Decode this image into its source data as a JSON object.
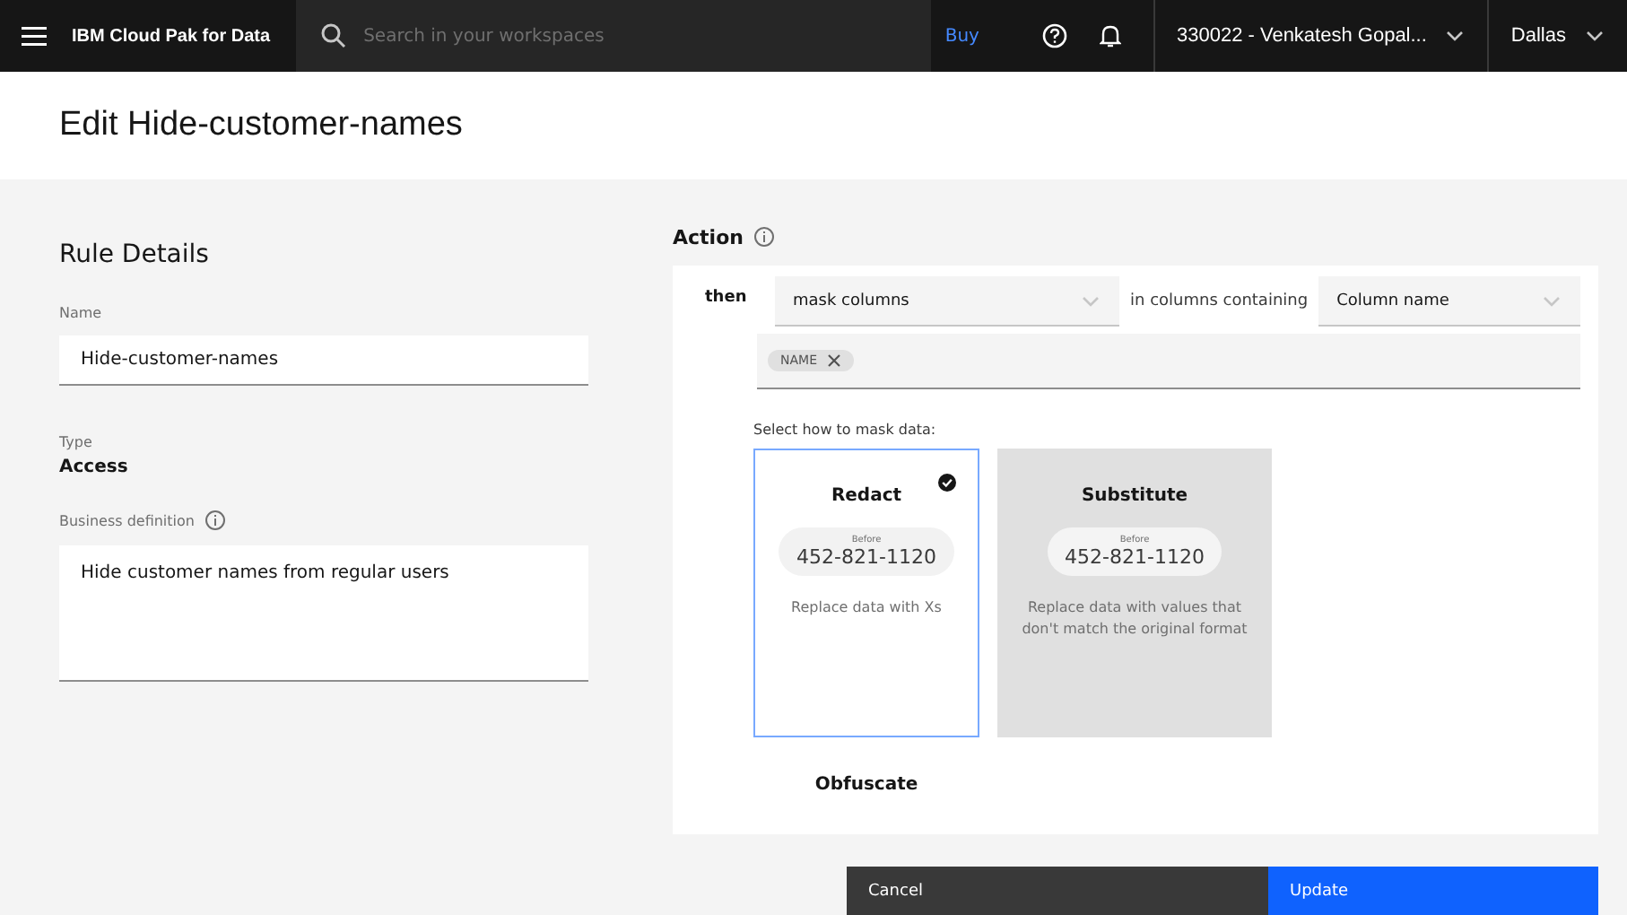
{
  "topbar": {
    "product": "IBM Cloud Pak for Data",
    "search": {
      "placeholder": "Search in your workspaces"
    },
    "buy": "Buy",
    "account": "330022 - Venkatesh Gopal...",
    "region": "Dallas"
  },
  "page": {
    "title": "Edit Hide-customer-names"
  },
  "rule_details": {
    "heading": "Rule Details",
    "name_label": "Name",
    "name_value": "Hide-customer-names",
    "type_label": "Type",
    "type_value": "Access",
    "definition_label": "Business definition",
    "definition_value": "Hide customer names from regular users"
  },
  "action": {
    "heading": "Action",
    "then": "then",
    "action_select": "mask columns",
    "connector": "in columns containing",
    "target_select": "Column name",
    "tags": [
      {
        "label": "NAME"
      }
    ],
    "mask_prompt": "Select how to mask data:",
    "methods": [
      {
        "title": "Redact",
        "sample_label": "Before",
        "sample": "452-821-1120",
        "description": "Replace data with Xs",
        "selected": true,
        "highlighted": false
      },
      {
        "title": "Substitute",
        "sample_label": "Before",
        "sample": "452-821-1120",
        "description": "Replace data with values that don't match the original format",
        "selected": false,
        "highlighted": true
      },
      {
        "title": "Obfuscate",
        "selected": false,
        "highlighted": false
      }
    ]
  },
  "buttons": [
    {
      "label": "Cancel",
      "kind": "secondary"
    },
    {
      "label": "Update",
      "kind": "primary"
    }
  ]
}
